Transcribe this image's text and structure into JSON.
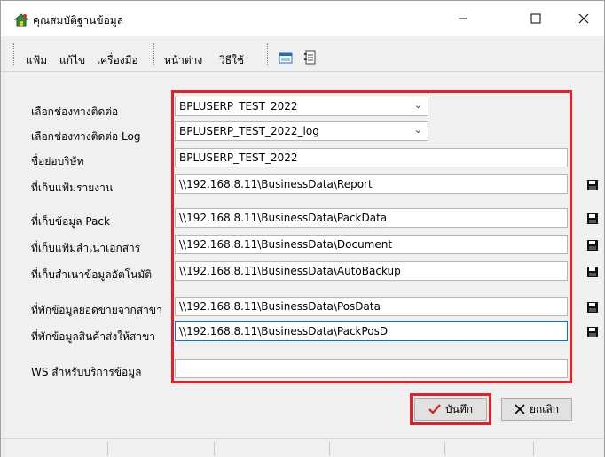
{
  "window": {
    "title": "คุณสมบัติฐานข้อมูล"
  },
  "menu": {
    "items": [
      "แฟ้ม",
      "แก้ไข",
      "เครื่องมือ",
      "หน้าต่าง",
      "วิธีใช้"
    ]
  },
  "toolbar": {
    "icons": [
      "window-icon",
      "notebook-icon"
    ]
  },
  "form": {
    "fields": [
      {
        "label": "เลือกช่องทางติดต่อ",
        "value": "BPLUSERP_TEST_2022",
        "type": "combo"
      },
      {
        "label": "เลือกช่องทางติดต่อ Log",
        "value": "BPLUSERP_TEST_2022_log",
        "type": "combo"
      },
      {
        "label": "ชื่อย่อบริษัท",
        "value": "BPLUSERP_TEST_2022",
        "type": "text"
      },
      {
        "label": "ที่เก็บแฟ้มรายงาน",
        "value": "\\\\192.168.8.11\\BusinessData\\Report",
        "type": "path"
      },
      {
        "label": "ที่เก็บข้อมูล Pack",
        "value": "\\\\192.168.8.11\\BusinessData\\PackData",
        "type": "path"
      },
      {
        "label": "ที่เก็บแฟ้มสำเนาเอกสาร",
        "value": "\\\\192.168.8.11\\BusinessData\\Document",
        "type": "path"
      },
      {
        "label": "ที่เก็บสำเนาข้อมูลอัตโนมัติ",
        "value": "\\\\192.168.8.11\\BusinessData\\AutoBackup",
        "type": "path"
      },
      {
        "label": "ที่พักข้อมูลยอดขายจากสาขา",
        "value": "\\\\192.168.8.11\\BusinessData\\PosData",
        "type": "path"
      },
      {
        "label": "ที่พักข้อมูลสินค้าส่งให้สาขา",
        "value": "\\\\192.168.8.11\\BusinessData\\PackPosD",
        "type": "path"
      },
      {
        "label": "WS สำหรับบริการข้อมูล",
        "value": "",
        "type": "text"
      }
    ]
  },
  "buttons": {
    "save": "บันทึก",
    "cancel": "ยกเลิก"
  },
  "colors": {
    "highlight": "#e2202c",
    "save_check": "#d21f1f"
  }
}
